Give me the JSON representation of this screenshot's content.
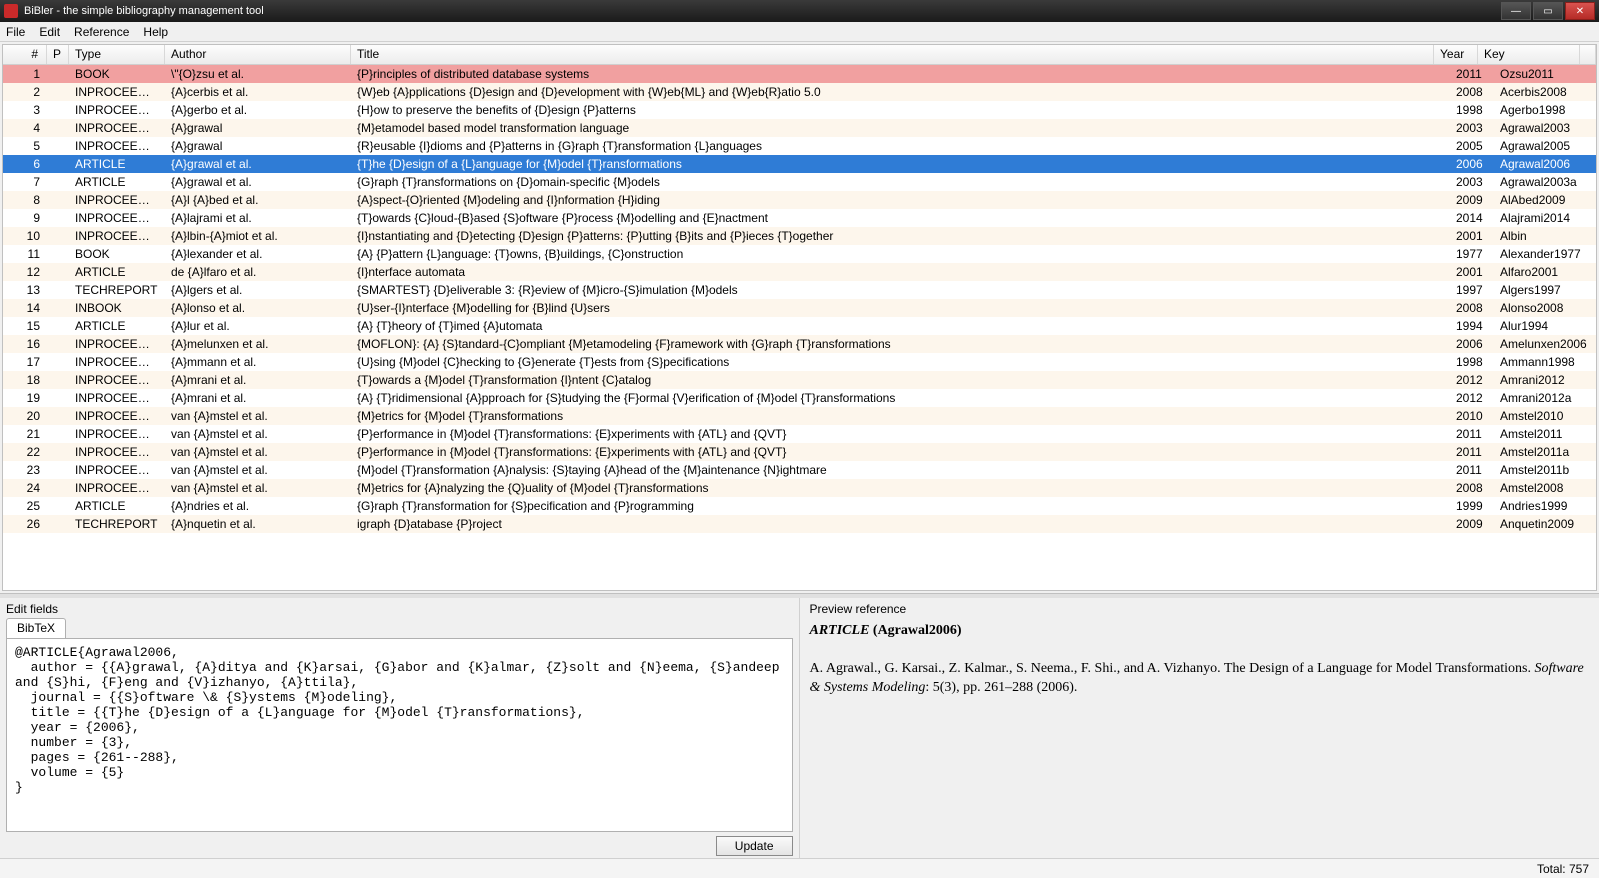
{
  "window": {
    "title": "BiBler - the simple bibliography management tool"
  },
  "menu": {
    "file": "File",
    "edit": "Edit",
    "reference": "Reference",
    "help": "Help"
  },
  "columns": {
    "num": "#",
    "p": "P",
    "type": "Type",
    "author": "Author",
    "title": "Title",
    "year": "Year",
    "key": "Key"
  },
  "rows": [
    {
      "n": "1",
      "type": "BOOK",
      "author": "\\\"{O}zsu et al.",
      "title": "{P}rinciples of distributed database systems",
      "year": "2011",
      "key": "Ozsu2011",
      "error": true
    },
    {
      "n": "2",
      "type": "INPROCEEDIN...",
      "author": "{A}cerbis et al.",
      "title": "{W}eb {A}pplications {D}esign and {D}evelopment with {W}eb{ML} and {W}eb{R}atio 5.0",
      "year": "2008",
      "key": "Acerbis2008"
    },
    {
      "n": "3",
      "type": "INPROCEEDIN...",
      "author": "{A}gerbo et al.",
      "title": "{H}ow to preserve the benefits of {D}esign {P}atterns",
      "year": "1998",
      "key": "Agerbo1998"
    },
    {
      "n": "4",
      "type": "INPROCEEDIN...",
      "author": "{A}grawal",
      "title": "{M}etamodel based model transformation language",
      "year": "2003",
      "key": "Agrawal2003"
    },
    {
      "n": "5",
      "type": "INPROCEEDIN...",
      "author": "{A}grawal",
      "title": "{R}eusable {I}dioms and {P}atterns in {G}raph {T}ransformation {L}anguages",
      "year": "2005",
      "key": "Agrawal2005"
    },
    {
      "n": "6",
      "type": "ARTICLE",
      "author": "{A}grawal et al.",
      "title": "{T}he {D}esign of a {L}anguage for {M}odel {T}ransformations",
      "year": "2006",
      "key": "Agrawal2006",
      "selected": true
    },
    {
      "n": "7",
      "type": "ARTICLE",
      "author": "{A}grawal et al.",
      "title": "{G}raph {T}ransformations on {D}omain-specific {M}odels",
      "year": "2003",
      "key": "Agrawal2003a"
    },
    {
      "n": "8",
      "type": "INPROCEEDIN...",
      "author": "{A}l {A}bed et al.",
      "title": "{A}spect-{O}riented {M}odeling and {I}nformation {H}iding",
      "year": "2009",
      "key": "AlAbed2009"
    },
    {
      "n": "9",
      "type": "INPROCEEDIN...",
      "author": "{A}lajrami et al.",
      "title": "{T}owards {C}loud-{B}ased {S}oftware {P}rocess {M}odelling and {E}nactment",
      "year": "2014",
      "key": "Alajrami2014"
    },
    {
      "n": "10",
      "type": "INPROCEEDIN...",
      "author": "{A}lbin-{A}miot et al.",
      "title": "{I}nstantiating and {D}etecting {D}esign {P}atterns: {P}utting {B}its and {P}ieces {T}ogether",
      "year": "2001",
      "key": "Albin"
    },
    {
      "n": "11",
      "type": "BOOK",
      "author": "{A}lexander et al.",
      "title": "{A} {P}attern {L}anguage: {T}owns, {B}uildings, {C}onstruction",
      "year": "1977",
      "key": "Alexander1977"
    },
    {
      "n": "12",
      "type": "ARTICLE",
      "author": "de {A}lfaro et al.",
      "title": "{I}nterface automata",
      "year": "2001",
      "key": "Alfaro2001"
    },
    {
      "n": "13",
      "type": "TECHREPORT",
      "author": "{A}lgers et al.",
      "title": "{SMARTEST} {D}eliverable 3: {R}eview of {M}icro-{S}imulation {M}odels",
      "year": "1997",
      "key": "Algers1997"
    },
    {
      "n": "14",
      "type": "INBOOK",
      "author": "{A}lonso et al.",
      "title": "{U}ser-{I}nterface {M}odelling for {B}lind {U}sers",
      "year": "2008",
      "key": "Alonso2008"
    },
    {
      "n": "15",
      "type": "ARTICLE",
      "author": "{A}lur et al.",
      "title": "{A} {T}heory of {T}imed {A}utomata",
      "year": "1994",
      "key": "Alur1994"
    },
    {
      "n": "16",
      "type": "INPROCEEDIN...",
      "author": "{A}melunxen et al.",
      "title": "{MOFLON}: {A} {S}tandard-{C}ompliant {M}etamodeling {F}ramework with {G}raph {T}ransformations",
      "year": "2006",
      "key": "Amelunxen2006"
    },
    {
      "n": "17",
      "type": "INPROCEEDIN...",
      "author": "{A}mmann et al.",
      "title": "{U}sing {M}odel {C}hecking to {G}enerate {T}ests from {S}pecifications",
      "year": "1998",
      "key": "Ammann1998"
    },
    {
      "n": "18",
      "type": "INPROCEEDIN...",
      "author": "{A}mrani et al.",
      "title": "{T}owards a {M}odel {T}ransformation {I}ntent {C}atalog",
      "year": "2012",
      "key": "Amrani2012"
    },
    {
      "n": "19",
      "type": "INPROCEEDIN...",
      "author": "{A}mrani et al.",
      "title": "{A} {T}ridimensional {A}pproach for {S}tudying the {F}ormal {V}erification of {M}odel {T}ransformations",
      "year": "2012",
      "key": "Amrani2012a"
    },
    {
      "n": "20",
      "type": "INPROCEEDIN...",
      "author": "van {A}mstel et al.",
      "title": "{M}etrics for {M}odel {T}ransformations",
      "year": "2010",
      "key": "Amstel2010"
    },
    {
      "n": "21",
      "type": "INPROCEEDIN...",
      "author": "van {A}mstel et al.",
      "title": "{P}erformance in {M}odel {T}ransformations: {E}xperiments with {ATL} and {QVT}",
      "year": "2011",
      "key": "Amstel2011"
    },
    {
      "n": "22",
      "type": "INPROCEEDIN...",
      "author": "van {A}mstel et al.",
      "title": "{P}erformance in {M}odel {T}ransformations: {E}xperiments with {ATL} and {QVT}",
      "year": "2011",
      "key": "Amstel2011a"
    },
    {
      "n": "23",
      "type": "INPROCEEDIN...",
      "author": "van {A}mstel et al.",
      "title": "{M}odel {T}ransformation {A}nalysis: {S}taying {A}head of the {M}aintenance {N}ightmare",
      "year": "2011",
      "key": "Amstel2011b"
    },
    {
      "n": "24",
      "type": "INPROCEEDIN...",
      "author": "van {A}mstel et al.",
      "title": "{M}etrics for {A}nalyzing the {Q}uality of {M}odel {T}ransformations",
      "year": "2008",
      "key": "Amstel2008"
    },
    {
      "n": "25",
      "type": "ARTICLE",
      "author": "{A}ndries et al.",
      "title": "{G}raph {T}ransformation for {S}pecification and {P}rogramming",
      "year": "1999",
      "key": "Andries1999"
    },
    {
      "n": "26",
      "type": "TECHREPORT",
      "author": "{A}nquetin et al.",
      "title": "igraph {D}atabase {P}roject",
      "year": "2009",
      "key": "Anquetin2009"
    }
  ],
  "edit": {
    "label": "Edit fields",
    "tab": "BibTeX",
    "content": "@ARTICLE{Agrawal2006,\n  author = {{A}grawal, {A}ditya and {K}arsai, {G}abor and {K}almar, {Z}solt and {N}eema, {S}andeep and {S}hi, {F}eng and {V}izhanyo, {A}ttila},\n  journal = {{S}oftware \\& {S}ystems {M}odeling},\n  title = {{T}he {D}esign of a {L}anguage for {M}odel {T}ransformations},\n  year = {2006},\n  number = {3},\n  pages = {261--288},\n  volume = {5}\n}",
    "update": "Update"
  },
  "preview": {
    "label": "Preview reference",
    "type": "ARTICLE",
    "key_display": " (Agrawal2006)",
    "body_prefix": "A. Agrawal., G. Karsai., Z. Kalmar., S. Neema., F. Shi., and A. Vizhanyo. The Design of a Language for Model Transformations. ",
    "journal": "Software & Systems Modeling",
    "body_suffix": ": 5(3), pp. 261–288 (2006)."
  },
  "status": {
    "total": "Total: 757"
  }
}
